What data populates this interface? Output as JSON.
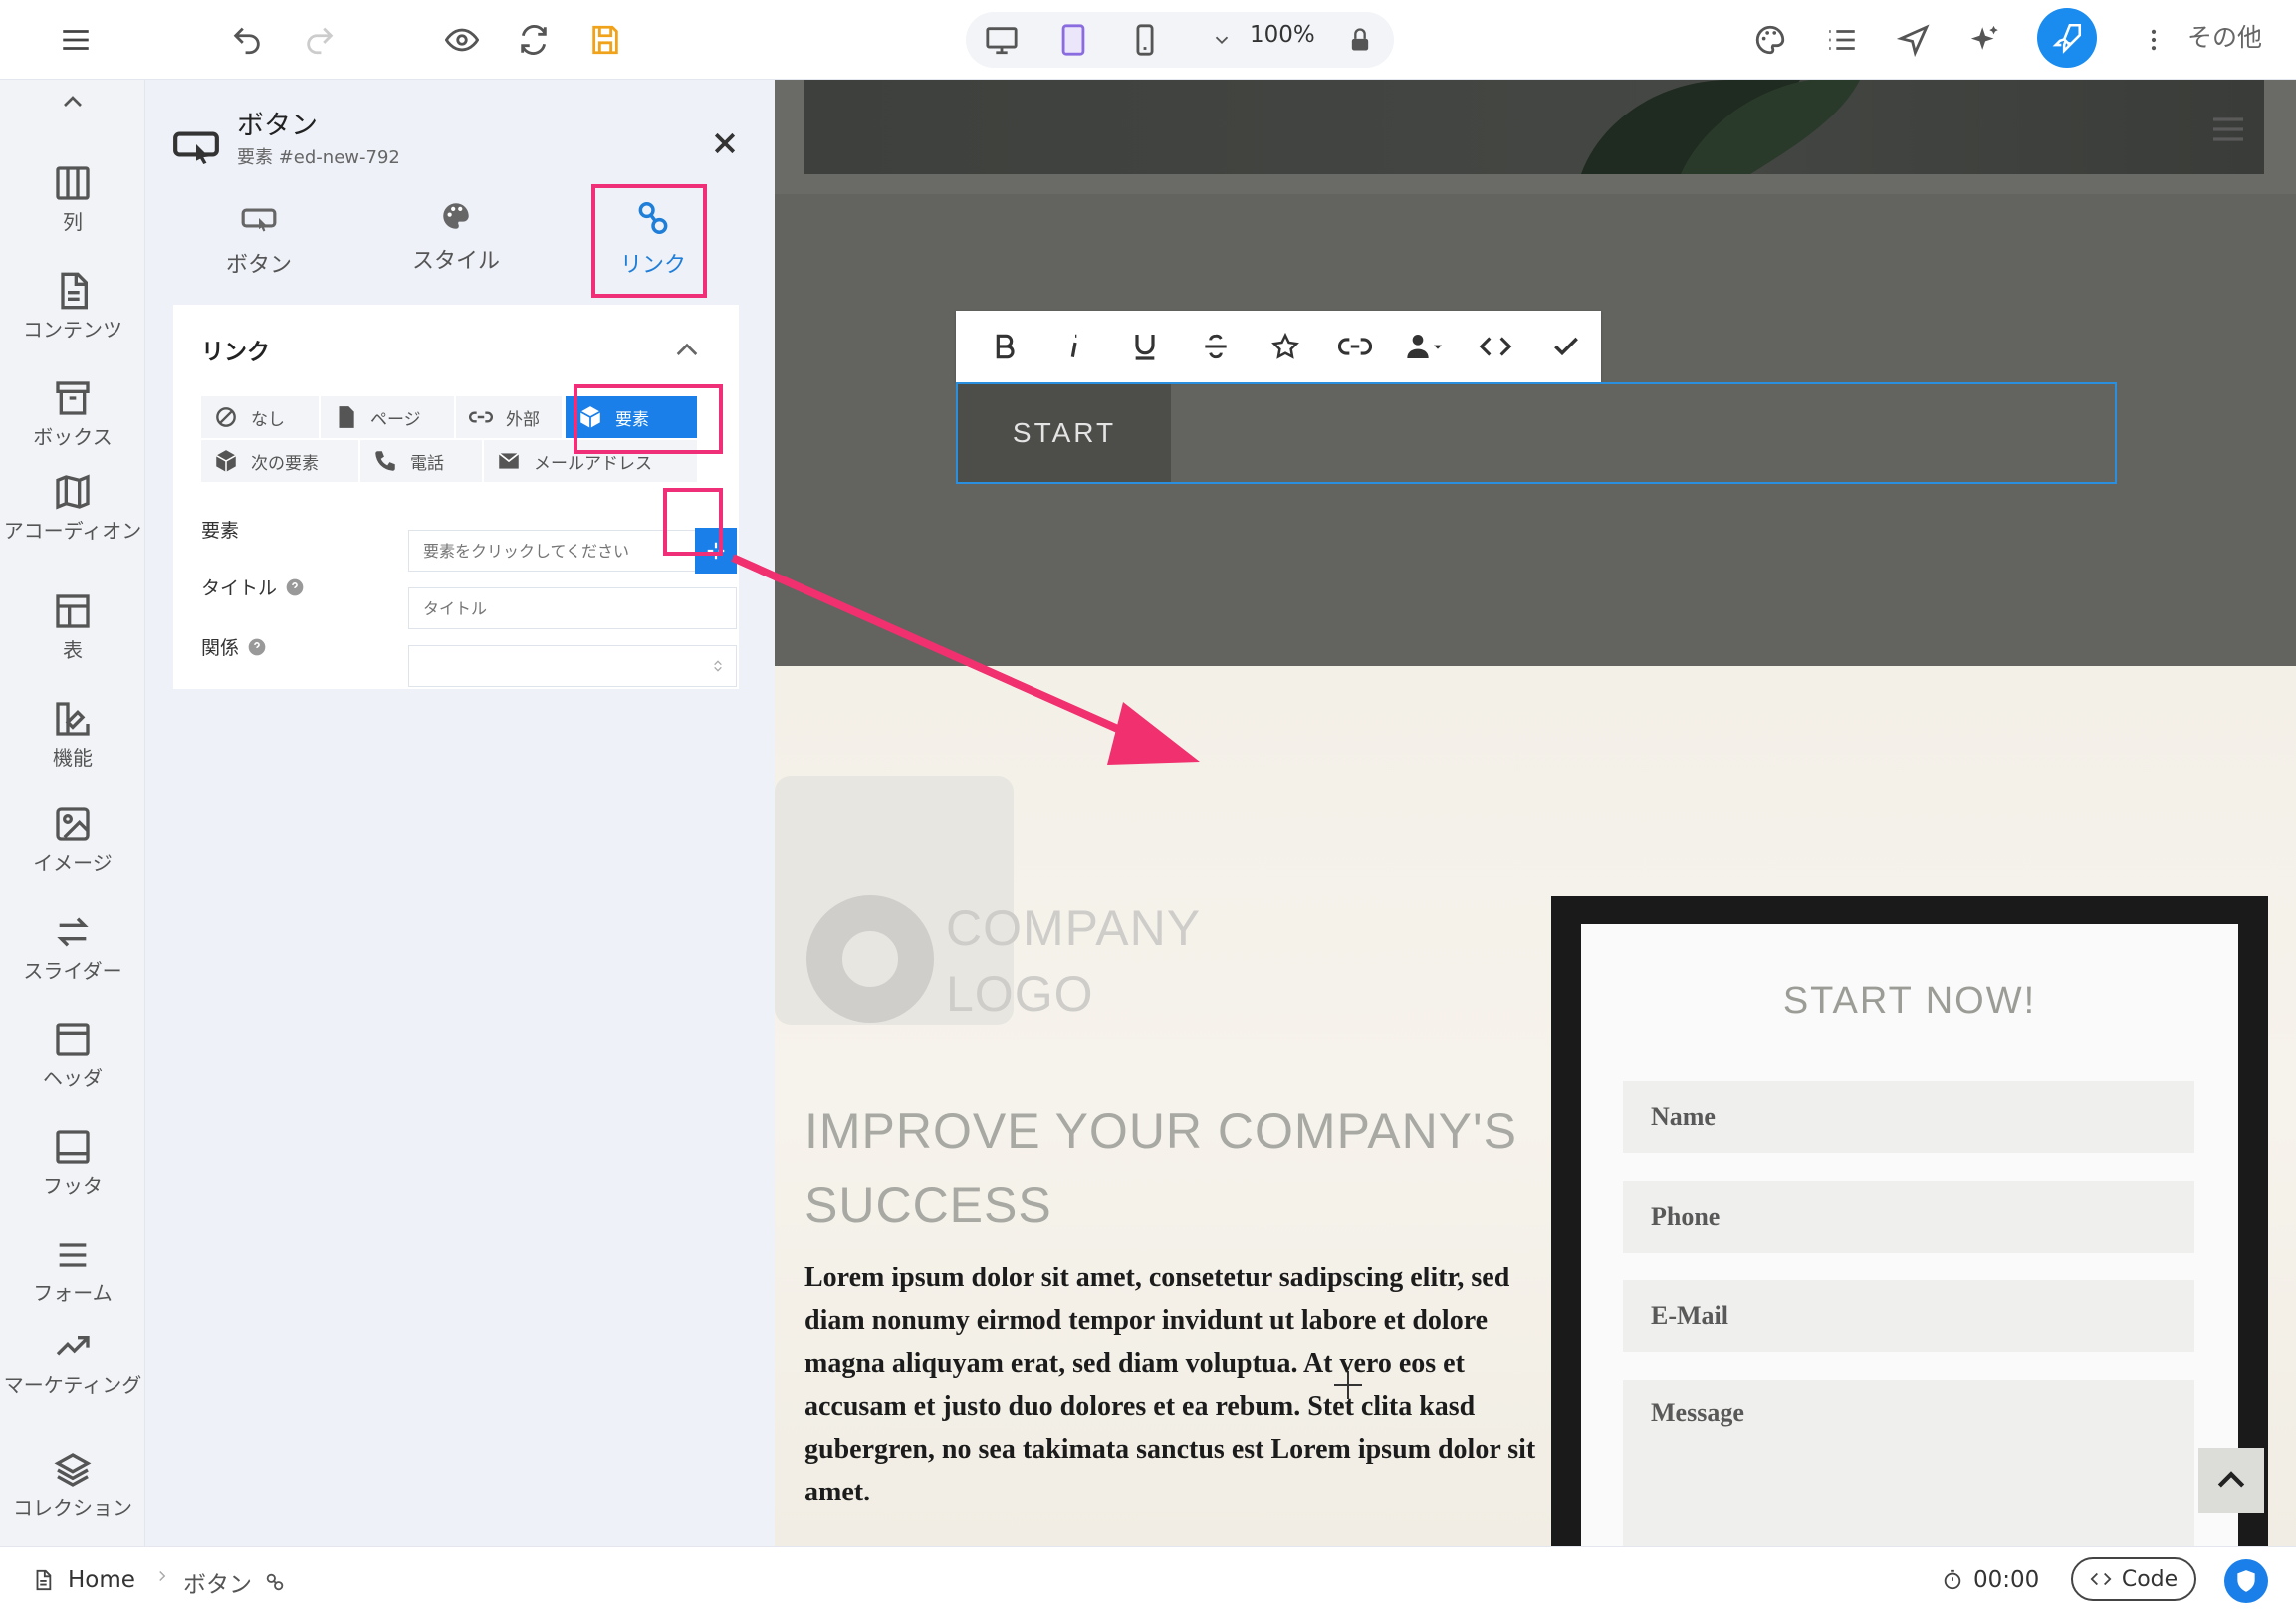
{
  "toolbar": {
    "zoom": "100%",
    "more_label": "その他"
  },
  "rail": {
    "items": [
      {
        "label": "列"
      },
      {
        "label": "コンテンツ"
      },
      {
        "label": "ボックス"
      },
      {
        "label": "アコーディオン"
      },
      {
        "label": "表"
      },
      {
        "label": "機能"
      },
      {
        "label": "イメージ"
      },
      {
        "label": "スライダー"
      },
      {
        "label": "ヘッダ"
      },
      {
        "label": "フッタ"
      },
      {
        "label": "フォーム"
      },
      {
        "label": "マーケティング"
      },
      {
        "label": "コレクション"
      }
    ]
  },
  "panel": {
    "title": "ボタン",
    "subtitle": "要素 #ed-new-792",
    "tabs": [
      {
        "label": "ボタン"
      },
      {
        "label": "スタイル"
      },
      {
        "label": "リンク"
      }
    ],
    "section_title": "リンク",
    "link_types": [
      {
        "label": "なし"
      },
      {
        "label": "ページ"
      },
      {
        "label": "外部"
      },
      {
        "label": "要素"
      },
      {
        "label": "次の要素"
      },
      {
        "label": "電話"
      },
      {
        "label": "メールアドレス"
      }
    ],
    "fields": {
      "element_label": "要素",
      "element_placeholder": "要素をクリックしてください",
      "title_label": "タイトル",
      "title_placeholder": "タイトル",
      "rel_label": "関係"
    }
  },
  "canvas": {
    "button_text": "START",
    "logo_line1": "COMPANY",
    "logo_line2": "LOGO",
    "headline": "IMPROVE YOUR COMPANY'S SUCCESS",
    "body": "Lorem ipsum dolor sit amet, consetetur sadipscing elitr, sed diam nonumy eirmod tempor invidunt ut labore et dolore magna aliquyam erat, sed diam voluptua. At vero eos et accusam et justo duo dolores et ea rebum. Stet clita kasd gubergren, no sea takimata sanctus est Lorem ipsum dolor sit amet.",
    "form": {
      "title": "START NOW!",
      "name_placeholder": "Name",
      "phone_placeholder": "Phone",
      "email_placeholder": "E-Mail",
      "message_placeholder": "Message"
    }
  },
  "status": {
    "home": "Home",
    "crumb": "ボタン",
    "time": "00:00",
    "code": "Code"
  },
  "colors": {
    "accent": "#1a7fe8",
    "highlight": "#ef2f78",
    "rocket": "#1a8cf0"
  }
}
